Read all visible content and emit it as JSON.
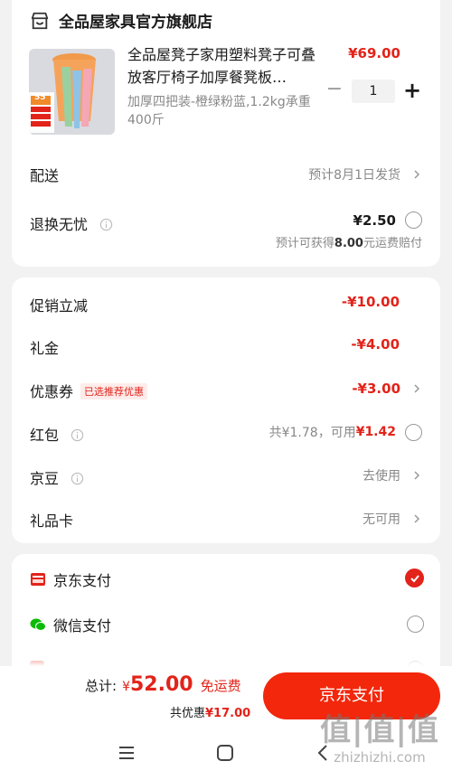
{
  "store": {
    "name": "全品屋家具官方旗舰店"
  },
  "product": {
    "title": "全品屋凳子家用塑料凳子可叠放客厅椅子加厚餐凳板…",
    "price": "¥69.00",
    "spec": "加厚四把装-橙绿粉蓝,1.2kg承重400斤",
    "quantity": "1",
    "thumb_badge": "55"
  },
  "delivery": {
    "label": "配送",
    "value": "预计8月1日发货"
  },
  "return": {
    "label": "退换无忧",
    "price": "¥2.50",
    "note_prefix": "预计可获得",
    "note_amount": "8.00",
    "note_suffix": "元运费赔付"
  },
  "discounts": {
    "promo": {
      "label": "促销立减",
      "value": "-¥10.00"
    },
    "gift_cash": {
      "label": "礼金",
      "value": "-¥4.00"
    },
    "coupon": {
      "label": "优惠券",
      "badge": "已选推荐优惠",
      "value": "-¥3.00"
    },
    "red_packet": {
      "label": "红包",
      "total": "共¥1.78，可用",
      "usable": "¥1.42"
    },
    "jd_bean": {
      "label": "京豆",
      "value": "去使用"
    },
    "gift_card": {
      "label": "礼品卡",
      "value": "无可用"
    }
  },
  "payment": {
    "jd_pay": "京东支付",
    "wechat_pay": "微信支付",
    "selected": "jd_pay"
  },
  "footer": {
    "total_label": "总计:",
    "currency": "¥",
    "total_amount": "52.00",
    "free_shipping": "免运费",
    "saving_label": "共优惠",
    "saving_amount": "¥17.00",
    "pay_button": "京东支付"
  },
  "watermark": {
    "big": "值|值|值",
    "small": "zhizhizhi.com"
  },
  "colors": {
    "accent": "#e2231a",
    "wechat": "#09bb07"
  }
}
